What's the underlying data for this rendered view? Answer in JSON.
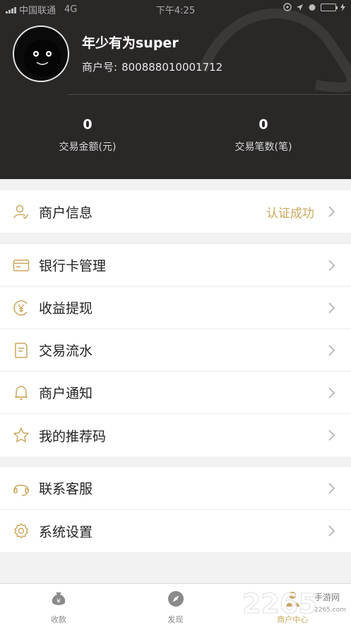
{
  "status_bar": {
    "carrier": "中国联通",
    "network": "4G",
    "time": "下午4:25"
  },
  "profile": {
    "username": "年少有为super",
    "merchant_no_label": "商户号:",
    "merchant_no": "800888010001712"
  },
  "stats": [
    {
      "value": "0",
      "label": "交易金额(元)"
    },
    {
      "value": "0",
      "label": "交易笔数(笔)"
    }
  ],
  "menu": {
    "group1": [
      {
        "label": "商户信息",
        "status": "认证成功",
        "icon": "user-check-icon"
      }
    ],
    "group2": [
      {
        "label": "银行卡管理",
        "icon": "bank-card-icon"
      },
      {
        "label": "收益提现",
        "icon": "yen-coin-icon"
      },
      {
        "label": "交易流水",
        "icon": "document-icon"
      },
      {
        "label": "商户通知",
        "icon": "bell-icon"
      },
      {
        "label": "我的推荐码",
        "icon": "star-icon"
      }
    ],
    "group3": [
      {
        "label": "联系客服",
        "icon": "headset-icon"
      },
      {
        "label": "系统设置",
        "icon": "gear-icon"
      }
    ]
  },
  "tabbar": [
    {
      "label": "收款",
      "icon": "money-bag-icon"
    },
    {
      "label": "发现",
      "icon": "compass-icon"
    },
    {
      "label": "商户中心",
      "icon": "merchant-icon",
      "active": true
    }
  ],
  "watermark": {
    "text": "2265",
    "sub": "手游网",
    "url": "2265.com"
  },
  "colors": {
    "accent": "#c9a75d",
    "header_bg": "#2a2727"
  }
}
